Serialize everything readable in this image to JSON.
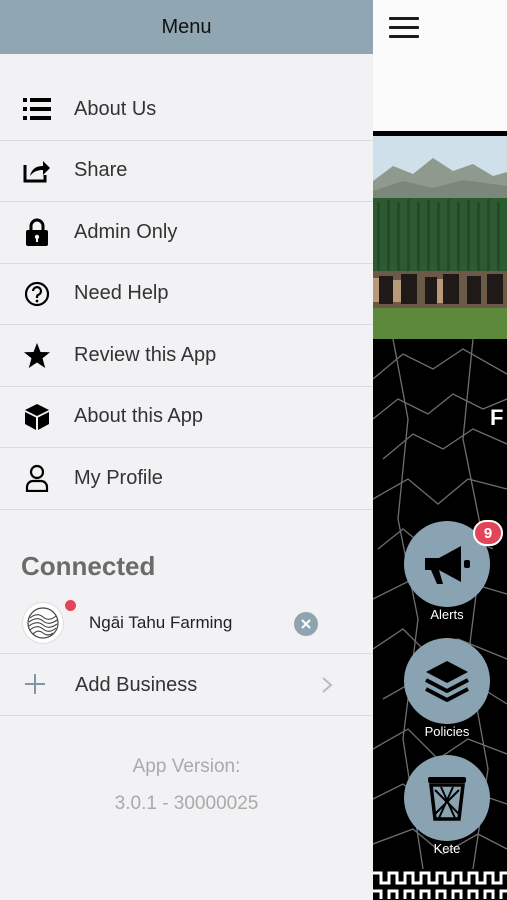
{
  "drawer": {
    "title": "Menu",
    "items": [
      {
        "label": "About Us",
        "icon": "list-icon"
      },
      {
        "label": "Share",
        "icon": "share-icon"
      },
      {
        "label": "Admin Only",
        "icon": "lock-icon"
      },
      {
        "label": "Need Help",
        "icon": "help-circle-icon"
      },
      {
        "label": "Review this App",
        "icon": "star-icon"
      },
      {
        "label": "About this App",
        "icon": "cube-icon"
      },
      {
        "label": "My Profile",
        "icon": "person-icon"
      }
    ],
    "connected": {
      "title": "Connected",
      "business_name": "Ngāi Tahu Farming",
      "add_label": "Add Business"
    },
    "version": {
      "label": "App Version:",
      "number": "3.0.1 - 30000025"
    }
  },
  "background_app": {
    "partial_text": "F",
    "buttons": [
      {
        "label": "Alerts",
        "icon": "megaphone-icon",
        "badge": "9"
      },
      {
        "label": "Policies",
        "icon": "layers-icon"
      },
      {
        "label": "Kete",
        "icon": "trash-basket-icon"
      }
    ]
  },
  "colors": {
    "header": "#91a6b3",
    "drawer_bg": "#f2f2f4",
    "button": "#8aa3b2",
    "badge": "#e0455a"
  }
}
